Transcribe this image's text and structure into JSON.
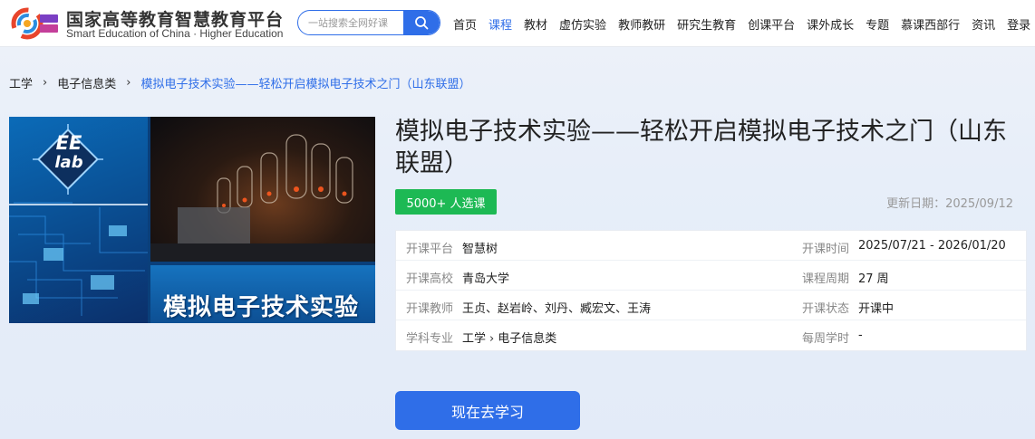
{
  "header": {
    "logo_cn": "国家高等教育智慧教育平台",
    "logo_en": "Smart Education of China · Higher Education",
    "search_placeholder": "一站搜索全网好课",
    "nav": [
      "首页",
      "课程",
      "教材",
      "虚仿实验",
      "教师教研",
      "研究生教育",
      "创课平台",
      "课外成长",
      "专题",
      "慕课西部行",
      "资讯",
      "登录"
    ],
    "active_nav": "课程"
  },
  "breadcrumb": {
    "items": [
      "工学",
      "电子信息类"
    ],
    "current": "模拟电子技术实验——轻松开启模拟电子技术之门（山东联盟）"
  },
  "cover": {
    "badge_line1": "EE",
    "badge_line2": "lab",
    "title": "模拟电子技术实验"
  },
  "course": {
    "title": "模拟电子技术实验——轻松开启模拟电子技术之门（山东联盟）",
    "enroll_badge": "5000+ 人选课",
    "update_date": "更新日期：2025/09/12",
    "info": {
      "platform_label": "开课平台",
      "platform": "智慧树",
      "time_label": "开课时间",
      "time": "2025/07/21 - 2026/01/20",
      "school_label": "开课高校",
      "school": "青岛大学",
      "period_label": "课程周期",
      "period": "27 周",
      "teacher_label": "开课教师",
      "teachers": "王贞、赵岩岭、刘丹、臧宏文、王涛",
      "status_label": "开课状态",
      "status": "开课中",
      "major_label": "学科专业",
      "major_1": "工学",
      "major_2": "电子信息类",
      "hours_label": "每周学时",
      "hours": "-"
    },
    "study_button": "现在去学习"
  },
  "colors": {
    "accent": "#2f6ee8",
    "badge_green": "#1db954"
  }
}
